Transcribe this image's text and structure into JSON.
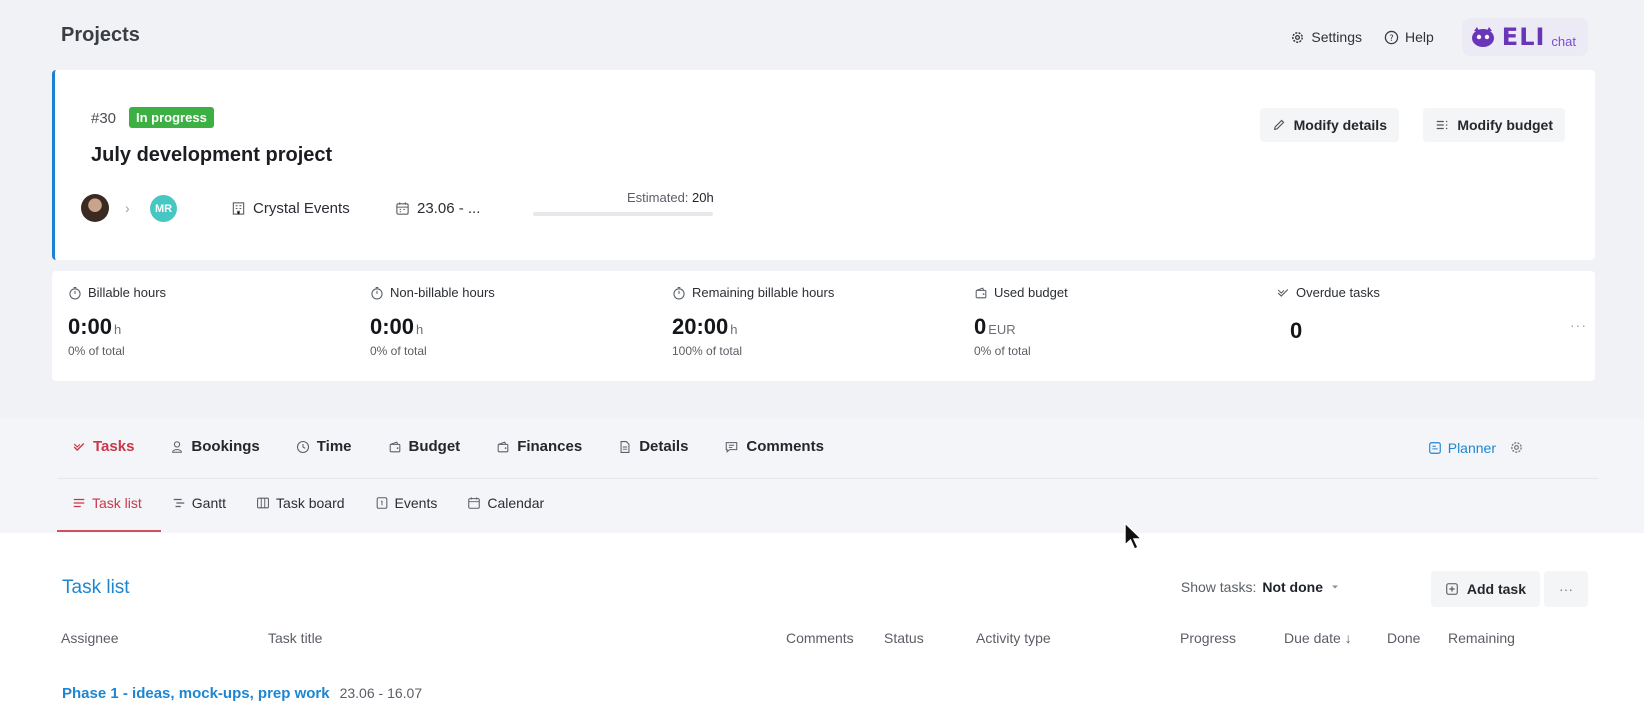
{
  "header": {
    "title": "Projects",
    "settings_label": "Settings",
    "help_label": "Help",
    "eli_brand": "ELI",
    "eli_sub": "chat"
  },
  "project": {
    "number": "#30",
    "status": "In progress",
    "title": "July development project",
    "assignee_initials": "MR",
    "client": "Crystal Events",
    "dates": "23.06 - ...",
    "estimated_label": "Estimated:",
    "estimated_value": "20h",
    "modify_details_label": "Modify details",
    "modify_budget_label": "Modify budget"
  },
  "stats": [
    {
      "label": "Billable hours",
      "value": "0:00",
      "unit": "h",
      "sub": "0% of total",
      "icon": "timer-icon"
    },
    {
      "label": "Non-billable hours",
      "value": "0:00",
      "unit": "h",
      "sub": "0% of total",
      "icon": "timer-icon"
    },
    {
      "label": "Remaining billable hours",
      "value": "20:00",
      "unit": "h",
      "sub": "100% of total",
      "icon": "timer-icon"
    },
    {
      "label": "Used budget",
      "value": "0",
      "unit": "EUR",
      "sub": "0% of total",
      "icon": "wallet-icon"
    },
    {
      "label": "Overdue tasks",
      "value": "0",
      "unit": "",
      "sub": "",
      "icon": "check-icon"
    }
  ],
  "tabs": {
    "main": [
      {
        "label": "Tasks",
        "icon": "check-icon",
        "active": true
      },
      {
        "label": "Bookings",
        "icon": "person-icon",
        "active": false
      },
      {
        "label": "Time",
        "icon": "clock-icon",
        "active": false
      },
      {
        "label": "Budget",
        "icon": "wallet-icon",
        "active": false
      },
      {
        "label": "Finances",
        "icon": "wallet-icon",
        "active": false
      },
      {
        "label": "Details",
        "icon": "document-icon",
        "active": false
      },
      {
        "label": "Comments",
        "icon": "comment-icon",
        "active": false
      }
    ],
    "planner_label": "Planner",
    "sub": [
      {
        "label": "Task list",
        "icon": "list-icon",
        "active": true
      },
      {
        "label": "Gantt",
        "icon": "gantt-icon",
        "active": false
      },
      {
        "label": "Task board",
        "icon": "board-icon",
        "active": false
      },
      {
        "label": "Events",
        "icon": "event-icon",
        "active": false
      },
      {
        "label": "Calendar",
        "icon": "calendar-icon",
        "active": false
      }
    ]
  },
  "task_list": {
    "title": "Task list",
    "show_tasks_label": "Show tasks:",
    "show_tasks_value": "Not done",
    "add_task_label": "Add task",
    "columns": [
      "Assignee",
      "Task title",
      "Comments",
      "Status",
      "Activity type",
      "Progress",
      "Due date ↓",
      "Done",
      "Remaining"
    ],
    "phase": {
      "title": "Phase 1 - ideas, mock-ups, prep work",
      "dates": "23.06 - 16.07"
    }
  },
  "colors": {
    "accent": "#1e86d1",
    "active_tab": "#c6384a",
    "status_green": "#3cb043",
    "avatar_teal": "#47c7c1"
  }
}
